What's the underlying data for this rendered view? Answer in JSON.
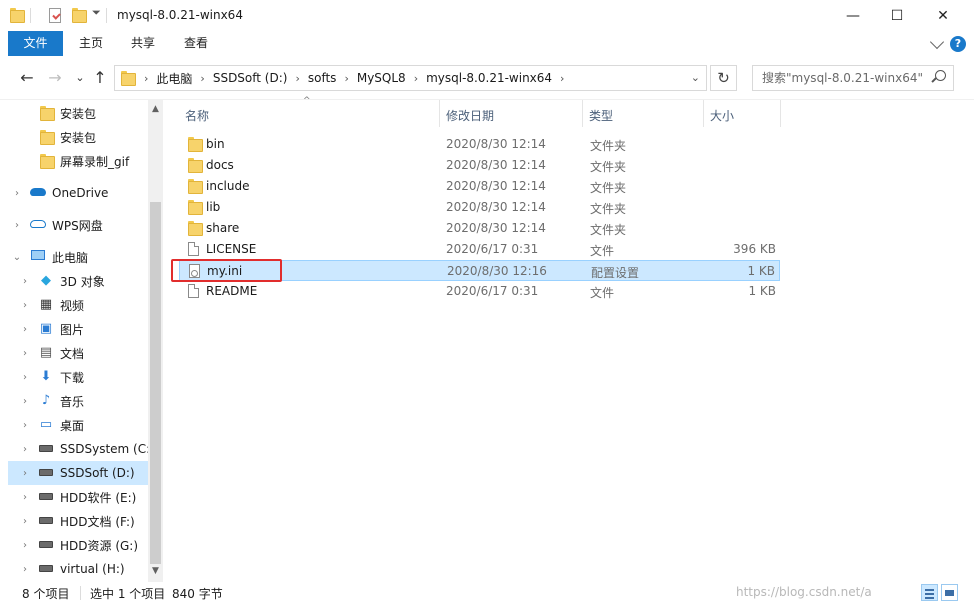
{
  "window": {
    "title": "mysql-8.0.21-winx64",
    "minimize_glyph": "—",
    "maximize_glyph": "☐",
    "close_glyph": "✕"
  },
  "ribbon": {
    "tabs": [
      {
        "label": "文件",
        "active": true
      },
      {
        "label": "主页"
      },
      {
        "label": "共享"
      },
      {
        "label": "查看"
      }
    ],
    "help_glyph": "?"
  },
  "navigation": {
    "back_glyph": "←",
    "forward_glyph": "→",
    "recent_glyph": "⌄",
    "up_glyph": "↑",
    "breadcrumb": [
      "此电脑",
      "SSDSoft (D:)",
      "softs",
      "MySQL8",
      "mysql-8.0.21-winx64"
    ],
    "breadcrumb_separator": "›",
    "dropdown_glyph": "⌄",
    "refresh_glyph": "↻",
    "search_placeholder": "搜索\"mysql-8.0.21-winx64\""
  },
  "nav_pane": {
    "items": [
      {
        "label": "安装包",
        "icon": "folder-icon",
        "expander": ""
      },
      {
        "label": "安装包",
        "icon": "folder-icon",
        "expander": ""
      },
      {
        "label": "屏幕录制_gif",
        "icon": "folder-icon",
        "expander": ""
      },
      {
        "label": "OneDrive",
        "icon": "onedrive-cloud-icon",
        "expander": "›"
      },
      {
        "label": "WPS网盘",
        "icon": "wps-cloud-icon",
        "expander": "›"
      },
      {
        "label": "此电脑",
        "icon": "this-pc-icon",
        "expander": "⌄"
      },
      {
        "label": "3D 对象",
        "icon": "3d-objects-icon",
        "expander": "›"
      },
      {
        "label": "视频",
        "icon": "videos-icon",
        "expander": "›"
      },
      {
        "label": "图片",
        "icon": "pictures-icon",
        "expander": "›"
      },
      {
        "label": "文档",
        "icon": "documents-icon",
        "expander": "›"
      },
      {
        "label": "下载",
        "icon": "downloads-icon",
        "expander": "›"
      },
      {
        "label": "音乐",
        "icon": "music-icon",
        "expander": "›"
      },
      {
        "label": "桌面",
        "icon": "desktop-icon",
        "expander": "›"
      },
      {
        "label": "SSDSystem (C:)",
        "icon": "system-drive-icon",
        "expander": "›"
      },
      {
        "label": "SSDSoft (D:)",
        "icon": "drive-icon",
        "expander": "›",
        "selected": true
      },
      {
        "label": "HDD软件 (E:)",
        "icon": "drive-icon",
        "expander": "›"
      },
      {
        "label": "HDD文档 (F:)",
        "icon": "drive-icon",
        "expander": "›"
      },
      {
        "label": "HDD资源 (G:)",
        "icon": "drive-icon",
        "expander": "›"
      },
      {
        "label": "virtual (H:)",
        "icon": "drive-icon",
        "expander": "›"
      }
    ],
    "scroll_up_glyph": "▲",
    "scroll_down_glyph": "▼"
  },
  "columns": {
    "name": "名称",
    "modified": "修改日期",
    "type": "类型",
    "size": "大小",
    "sort_glyph": "^"
  },
  "files": [
    {
      "name": "bin",
      "modified": "2020/8/30 12:14",
      "type": "文件夹",
      "size": "",
      "icon": "folder-icon"
    },
    {
      "name": "docs",
      "modified": "2020/8/30 12:14",
      "type": "文件夹",
      "size": "",
      "icon": "folder-icon"
    },
    {
      "name": "include",
      "modified": "2020/8/30 12:14",
      "type": "文件夹",
      "size": "",
      "icon": "folder-icon"
    },
    {
      "name": "lib",
      "modified": "2020/8/30 12:14",
      "type": "文件夹",
      "size": "",
      "icon": "folder-icon"
    },
    {
      "name": "share",
      "modified": "2020/8/30 12:14",
      "type": "文件夹",
      "size": "",
      "icon": "folder-icon"
    },
    {
      "name": "LICENSE",
      "modified": "2020/6/17 0:31",
      "type": "文件",
      "size": "396 KB",
      "icon": "file-icon"
    },
    {
      "name": "my.ini",
      "modified": "2020/8/30 12:16",
      "type": "配置设置",
      "size": "1 KB",
      "icon": "config-file-icon",
      "selected": true
    },
    {
      "name": "README",
      "modified": "2020/6/17 0:31",
      "type": "文件",
      "size": "1 KB",
      "icon": "file-icon"
    }
  ],
  "status": {
    "item_count": "8 个项目",
    "selection": "选中 1 个项目",
    "selection_size": "840 字节",
    "watermark": "https://blog.csdn.net/a"
  },
  "colors": {
    "accent": "#1979ca",
    "selection": "#cce8ff",
    "highlight_box": "#e12d2d"
  }
}
